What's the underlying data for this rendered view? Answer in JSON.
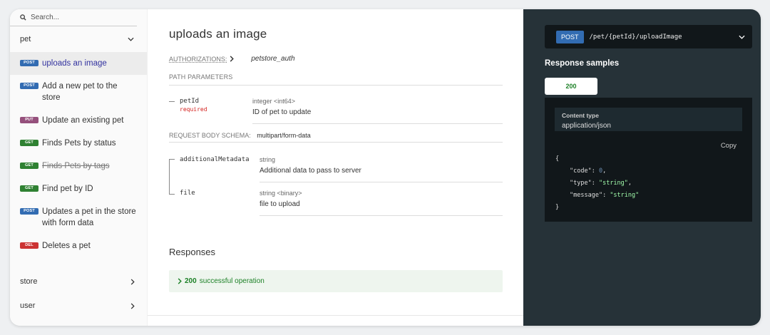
{
  "sidebar": {
    "search_placeholder": "Search...",
    "groups": {
      "pet": "pet",
      "store": "store",
      "user": "user"
    },
    "operations": [
      {
        "method": "POST",
        "label": "uploads an image",
        "color": "#326cb2",
        "active": true
      },
      {
        "method": "POST",
        "label": "Add a new pet to the store",
        "color": "#326cb2"
      },
      {
        "method": "PUT",
        "label": "Update an existing pet",
        "color": "#95507c"
      },
      {
        "method": "GET",
        "label": "Finds Pets by status",
        "color": "#2f8132"
      },
      {
        "method": "GET",
        "label": "Finds Pets by tags",
        "color": "#2f8132",
        "deprecated": true
      },
      {
        "method": "GET",
        "label": "Find pet by ID",
        "color": "#2f8132"
      },
      {
        "method": "POST",
        "label": "Updates a pet in the store with form data",
        "color": "#326cb2"
      },
      {
        "method": "DEL",
        "label": "Deletes a pet",
        "color": "#cc3333"
      }
    ]
  },
  "main": {
    "title": "uploads an image",
    "authorizations_label": "AUTHORIZATIONS:",
    "authorizations_value": "petstore_auth",
    "path_params_label": "PATH PARAMETERS",
    "path_param": {
      "name": "petId",
      "required": "required",
      "type": "integer <int64>",
      "description": "ID of pet to update"
    },
    "request_body_label": "REQUEST BODY SCHEMA:",
    "request_body_type": "multipart/form-data",
    "body_fields": [
      {
        "name": "additionalMetadata",
        "type": "string",
        "description": "Additional data to pass to server"
      },
      {
        "name": "file",
        "type": "string <binary>",
        "description": "file to upload"
      }
    ],
    "responses_title": "Responses",
    "response": {
      "code": "200",
      "text": "successful operation"
    }
  },
  "right": {
    "method": "POST",
    "path": "/pet/{petId}/uploadImage",
    "samples_title": "Response samples",
    "status_tab": "200",
    "content_type_label": "Content type",
    "content_type_value": "application/json",
    "copy_label": "Copy",
    "json": {
      "open": "{",
      "code_key": "\"code\"",
      "code_val": "0",
      "type_key": "\"type\"",
      "type_val": "\"string\"",
      "message_key": "\"message\"",
      "message_val": "\"string\"",
      "close": "}"
    }
  },
  "colors": {
    "accent": "#32329f",
    "success": "#1d8127",
    "dark_panel": "#263238",
    "code_bg": "#11171a"
  }
}
